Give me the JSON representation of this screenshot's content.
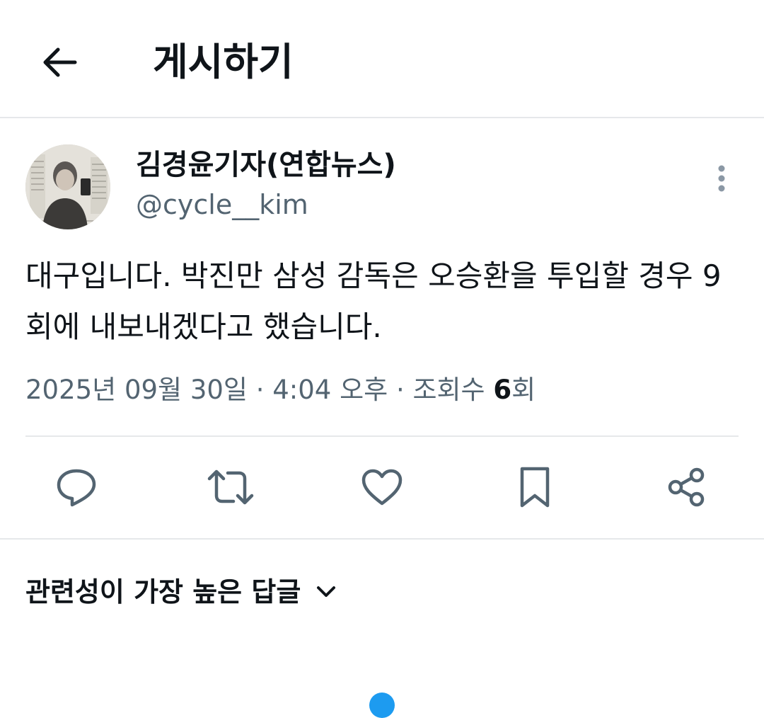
{
  "header": {
    "title": "게시하기",
    "back_icon": "arrow-left-icon"
  },
  "author": {
    "display_name": "김경윤기자(연합뉴스)",
    "handle": "@cycle__kim"
  },
  "tweet": {
    "text": "대구입니다. 박진만 삼성 감독은 오승환을 투입할 경우 9회에 내보내겠다고 했습니다.",
    "timestamp": "2025년 09월 30일 · 4:04 오후 · 조회수 ",
    "views_count": "6",
    "views_suffix": "회"
  },
  "actions": [
    {
      "name": "reply",
      "icon": "reply-icon"
    },
    {
      "name": "retweet",
      "icon": "retweet-icon"
    },
    {
      "name": "like",
      "icon": "heart-icon"
    },
    {
      "name": "bookmark",
      "icon": "bookmark-icon"
    },
    {
      "name": "share",
      "icon": "share-icon"
    }
  ],
  "replies": {
    "sort_label": "관련성이 가장 높은 답글"
  },
  "colors": {
    "text_primary": "#0f1419",
    "text_secondary": "#536471",
    "divider": "#e6e8ea",
    "accent": "#1d9bf0"
  }
}
